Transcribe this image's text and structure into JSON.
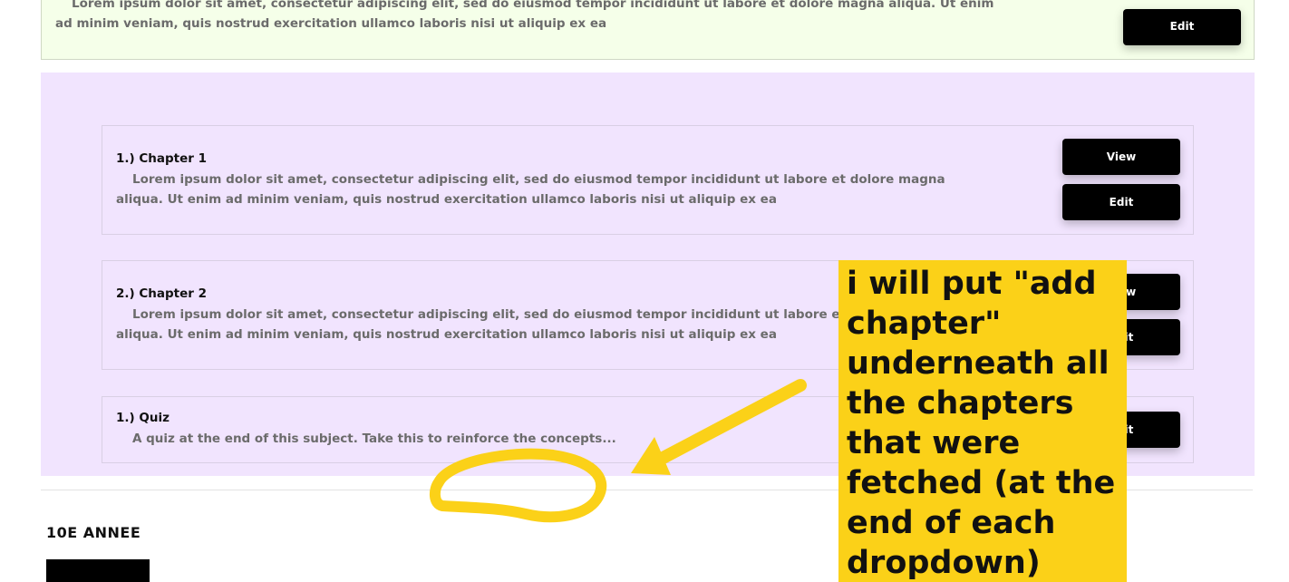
{
  "top_card": {
    "description": "Lorem ipsum dolor sit amet, consectetur adipiscing elit, sed do eiusmod tempor incididunt ut labore et dolore magna aliqua. Ut enim ad minim veniam, quis nostrud exercitation ullamco laboris nisi ut aliquip ex ea",
    "edit_label": "Edit"
  },
  "items": [
    {
      "title": "1.) Chapter 1",
      "description": "Lorem ipsum dolor sit amet, consectetur adipiscing elit, sed do eiusmod tempor incididunt ut labore et dolore magna aliqua. Ut enim ad minim veniam, quis nostrud exercitation ullamco laboris nisi ut aliquip ex ea",
      "view_label": "View",
      "edit_label": "Edit"
    },
    {
      "title": "2.) Chapter 2",
      "description": "Lorem ipsum dolor sit amet, consectetur adipiscing elit, sed do eiusmod tempor incididunt ut labore et dolore magna aliqua. Ut enim ad minim veniam, quis nostrud exercitation ullamco laboris nisi ut aliquip ex ea",
      "view_label": "View",
      "edit_label": "Edit"
    },
    {
      "title": "1.) Quiz",
      "description": "A quiz at the end of this subject. Take this to reinforce the concepts...",
      "edit_label": "Edit"
    }
  ],
  "grade": {
    "title": "10E ANNEE"
  },
  "annotation": {
    "text": "i will put \"add chapter\" underneath all the chapters that were fetched (at the end of each dropdown)",
    "color": "#fbd118"
  },
  "colors": {
    "top_card_bg": "#f5ffe9",
    "section_bg": "#f1e4fe",
    "button_bg": "#000000"
  }
}
